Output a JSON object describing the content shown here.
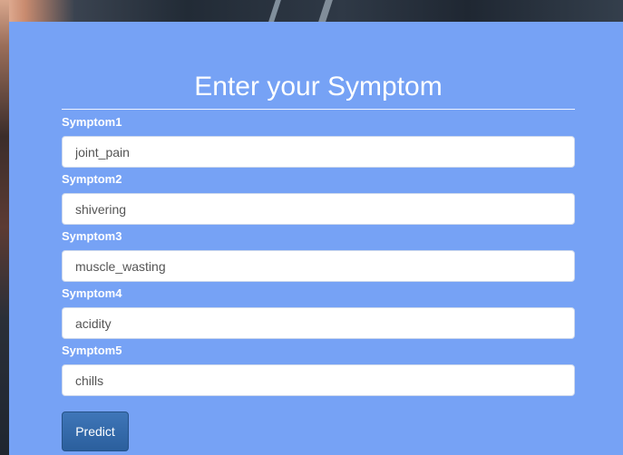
{
  "form": {
    "title": "Enter your Symptom",
    "fields": [
      {
        "label": "Symptom1",
        "value": "joint_pain"
      },
      {
        "label": "Symptom2",
        "value": "shivering"
      },
      {
        "label": "Symptom3",
        "value": "muscle_wasting"
      },
      {
        "label": "Symptom4",
        "value": "acidity"
      },
      {
        "label": "Symptom5",
        "value": "chills"
      }
    ],
    "submit_label": "Predict"
  },
  "colors": {
    "panel": "#76a2f5",
    "button": "#2f66a8",
    "text_on_panel": "#ffffff"
  }
}
